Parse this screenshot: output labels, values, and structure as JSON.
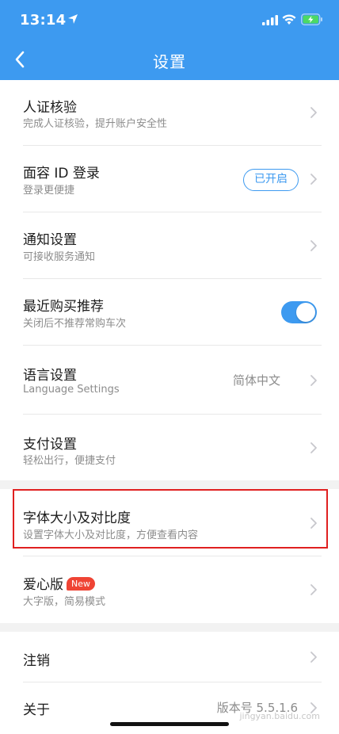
{
  "status_bar": {
    "time": "13:14"
  },
  "nav": {
    "title": "设置"
  },
  "rows": {
    "identity": {
      "title": "人证核验",
      "subtitle": "完成人证核验，提升账户安全性"
    },
    "face_id": {
      "title": "面容 ID 登录",
      "subtitle": "登录更便捷",
      "status_pill": "已开启"
    },
    "notify": {
      "title": "通知设置",
      "subtitle": "可接收服务通知"
    },
    "recent": {
      "title": "最近购买推荐",
      "subtitle": "关闭后不推荐常购车次",
      "toggle_on": true
    },
    "language": {
      "title": "语言设置",
      "subtitle": "Language Settings",
      "value": "简体中文"
    },
    "payment": {
      "title": "支付设置",
      "subtitle": "轻松出行，便捷支付"
    },
    "font": {
      "title": "字体大小及对比度",
      "subtitle": "设置字体大小及对比度，方便查看内容"
    },
    "care": {
      "title": "爱心版",
      "badge": "New",
      "subtitle": "大字版，简易模式"
    },
    "logout": {
      "title": "注销"
    },
    "about": {
      "title": "关于",
      "value": "版本号 5.5.1.6"
    }
  },
  "watermark": {
    "line1": "",
    "line2": "jingyan.baidu.com"
  },
  "colors": {
    "accent": "#3d9af0",
    "highlight": "#e02020",
    "badge": "#ef4434"
  }
}
